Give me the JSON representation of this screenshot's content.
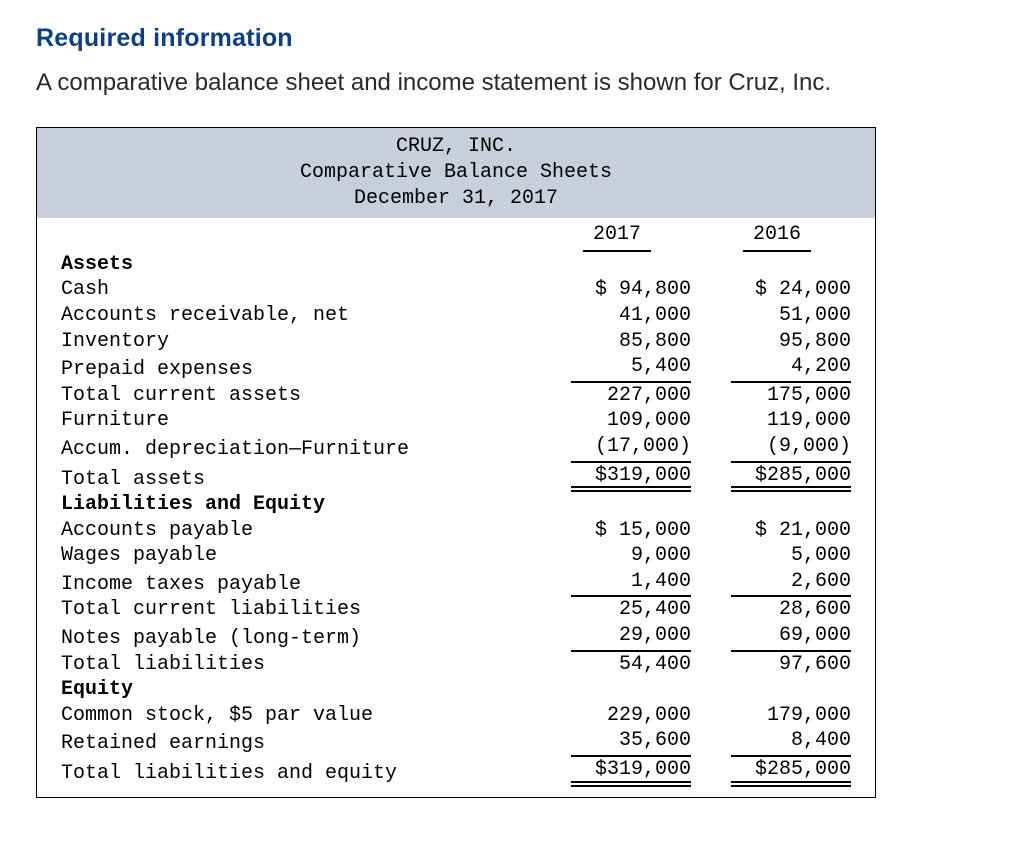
{
  "heading": "Required information",
  "intro": "A comparative balance sheet and income statement is shown for Cruz, Inc.",
  "header": {
    "company": "CRUZ, INC.",
    "title": "Comparative Balance Sheets",
    "date": "December 31, 2017"
  },
  "years": {
    "left": "2017",
    "right": "2016"
  },
  "sections": {
    "assets_label": "Assets",
    "liab_eq_label": "Liabilities and Equity",
    "equity_label": "Equity"
  },
  "rows": {
    "cash": {
      "label": "Cash",
      "y17": "$ 94,800",
      "y16": "$ 24,000"
    },
    "ar": {
      "label": "Accounts receivable, net",
      "y17": "41,000",
      "y16": "51,000"
    },
    "inventory": {
      "label": "Inventory",
      "y17": "85,800",
      "y16": "95,800"
    },
    "prepaid": {
      "label": "Prepaid expenses",
      "y17": "5,400",
      "y16": "4,200"
    },
    "tca": {
      "label": "Total current assets",
      "y17": "227,000",
      "y16": "175,000"
    },
    "furniture": {
      "label": "Furniture",
      "y17": "109,000",
      "y16": "119,000"
    },
    "accdep": {
      "label": "Accum. depreciation—Furniture",
      "y17": "(17,000)",
      "y16": "(9,000)"
    },
    "ta": {
      "label": "Total assets",
      "y17": "$319,000",
      "y16": "$285,000"
    },
    "ap": {
      "label": "Accounts payable",
      "y17": "$ 15,000",
      "y16": "$ 21,000"
    },
    "wp": {
      "label": "Wages payable",
      "y17": "9,000",
      "y16": "5,000"
    },
    "itp": {
      "label": "Income taxes payable",
      "y17": "1,400",
      "y16": "2,600"
    },
    "tcl": {
      "label": "Total current liabilities",
      "y17": "25,400",
      "y16": "28,600"
    },
    "np": {
      "label": "Notes payable (long-term)",
      "y17": "29,000",
      "y16": "69,000"
    },
    "tl": {
      "label": "Total liabilities",
      "y17": "54,400",
      "y16": "97,600"
    },
    "cs": {
      "label": "Common stock, $5 par value",
      "y17": "229,000",
      "y16": "179,000"
    },
    "re": {
      "label": "Retained earnings",
      "y17": "35,600",
      "y16": "8,400"
    },
    "tle": {
      "label": "Total liabilities and equity",
      "y17": "$319,000",
      "y16": "$285,000"
    }
  }
}
